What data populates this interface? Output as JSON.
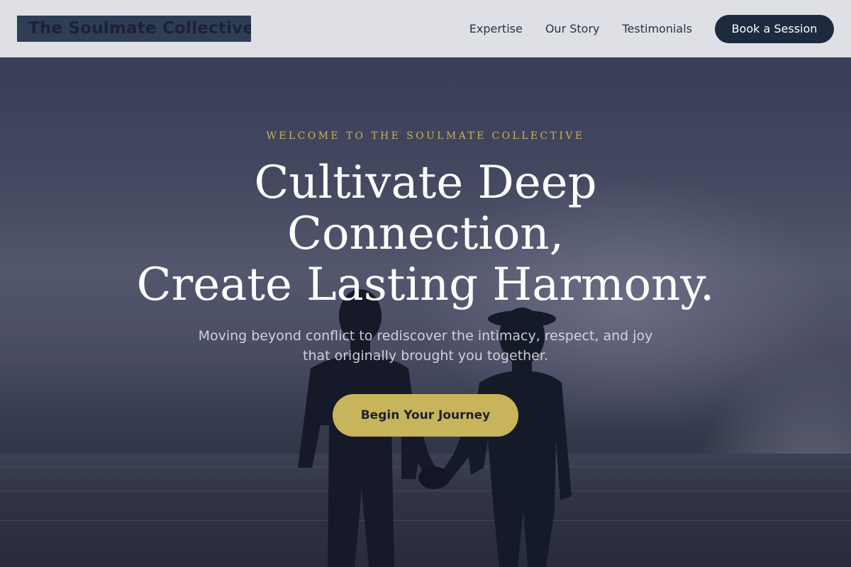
{
  "brand": {
    "name": "The Soulmate Collective"
  },
  "nav": {
    "links": [
      {
        "label": "Expertise"
      },
      {
        "label": "Our Story"
      },
      {
        "label": "Testimonials"
      }
    ],
    "cta_label": "Book a Session"
  },
  "hero": {
    "eyebrow": "WELCOME TO THE SOULMATE COLLECTIVE",
    "headline_lines": [
      "Cultivate Deep",
      "Connection,",
      "Create Lasting Harmony."
    ],
    "subtext_lines": [
      "Moving beyond conflict to rediscover the intimacy, respect, and joy",
      "that originally brought you together."
    ],
    "cta_label": "Begin Your Journey",
    "background_image": "silhouette of a couple holding hands facing the sea at dusk"
  },
  "colors": {
    "header_bg": "#e8e9ee",
    "navy": "#1e2a40",
    "gold": "#c8b45a",
    "eyebrow_gold": "#c9b15c",
    "headline": "#ffffff"
  }
}
